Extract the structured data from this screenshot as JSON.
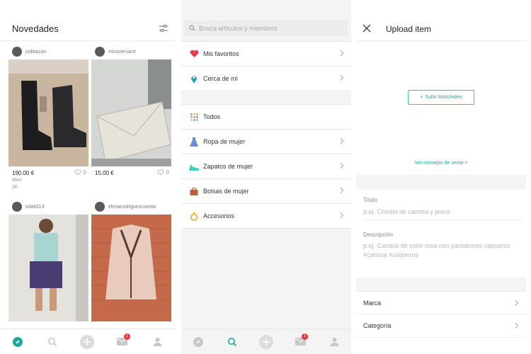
{
  "feed": {
    "title": "Novedades",
    "cards": [
      {
        "user": "juditaizan",
        "price": "190.00 €",
        "likes": "0",
        "size": "Mou",
        "extra": "36"
      },
      {
        "user": "missversace",
        "price": "15.00 €",
        "likes": "0"
      },
      {
        "user": "lola9214"
      },
      {
        "user": "elenarodriguezcuesta"
      }
    ],
    "tab_badge": "1"
  },
  "browse": {
    "search_placeholder": "Busca artículos y miembros",
    "top_items": [
      {
        "label": "Mis favoritos",
        "icon": "heart-icon",
        "color": "#e8384f"
      },
      {
        "label": "Cerca de mí",
        "icon": "location-pin-icon",
        "color": "#21a59f"
      }
    ],
    "category_items": [
      {
        "label": "Todos",
        "icon": "grid-dots-icon"
      },
      {
        "label": "Ropa de mujer",
        "icon": "dress-icon",
        "color": "#6b8fd6"
      },
      {
        "label": "Zapatos de mujer",
        "icon": "heel-shoe-icon",
        "color": "#3fd3c0"
      },
      {
        "label": "Bolsas de mujer",
        "icon": "handbag-icon",
        "color": "#b8613a"
      },
      {
        "label": "Accesorios",
        "icon": "ring-icon",
        "color": "#f0a830"
      }
    ],
    "tab_badge": "1"
  },
  "upload": {
    "title": "Upload item",
    "upload_button": "Subir fotos/video",
    "tips_link": "Ver consejos de venta >",
    "title_label": "Título",
    "title_placeholder": "p.ej. Combo de camisa y jeans",
    "description_label": "Descripción",
    "description_placeholder": "p.ej. Camisa de color rosa con pantalones vaqueros #camisa #vaqueros",
    "brand_label": "Marca",
    "category_label": "Categoría"
  },
  "colors": {
    "accent": "#21a59f",
    "badge": "#e8383d"
  }
}
